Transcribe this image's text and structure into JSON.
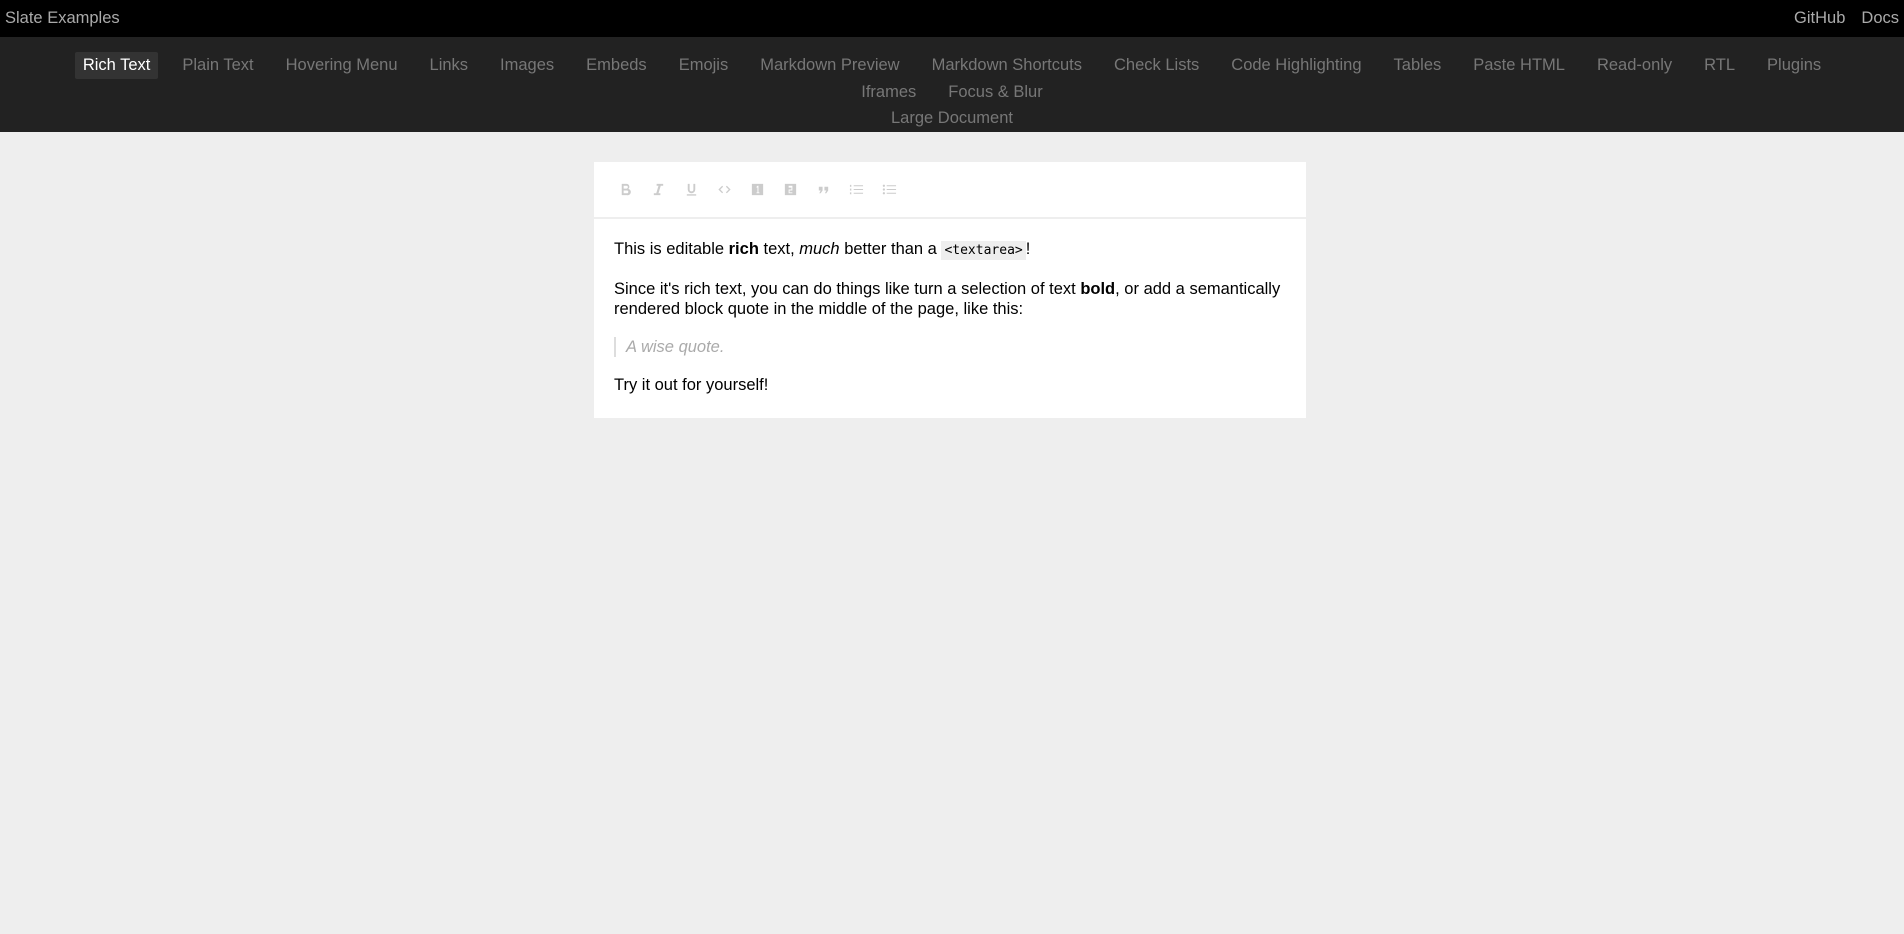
{
  "header": {
    "title": "Slate Examples",
    "links": [
      "GitHub",
      "Docs"
    ]
  },
  "tabs": [
    "Rich Text",
    "Plain Text",
    "Hovering Menu",
    "Links",
    "Images",
    "Embeds",
    "Emojis",
    "Markdown Preview",
    "Markdown Shortcuts",
    "Check Lists",
    "Code Highlighting",
    "Tables",
    "Paste HTML",
    "Read-only",
    "RTL",
    "Plugins",
    "Iframes",
    "Focus & Blur",
    "Large Document"
  ],
  "active_tab": "Rich Text",
  "toolbar": {
    "buttons": [
      {
        "icon": "bold-icon"
      },
      {
        "icon": "italic-icon"
      },
      {
        "icon": "underline-icon"
      },
      {
        "icon": "code-icon"
      },
      {
        "icon": "heading-one-icon"
      },
      {
        "icon": "heading-two-icon"
      },
      {
        "icon": "block-quote-icon"
      },
      {
        "icon": "numbered-list-icon"
      },
      {
        "icon": "bulleted-list-icon"
      }
    ]
  },
  "editor": {
    "p1": {
      "t1": "This is editable ",
      "bold": "rich",
      "t2": " text, ",
      "italic": "much",
      "t3": " better than a ",
      "code": "<textarea>",
      "t4": "!"
    },
    "p2": {
      "t1": "Since it's rich text, you can do things like turn a selection of text ",
      "bold": "bold",
      "t2": ", or add a semantically rendered block quote in the middle of the page, like this:"
    },
    "quote": "A wise quote.",
    "p3": "Try it out for yourself!"
  },
  "colors": {
    "topbar_bg": "#000000",
    "tabsbar_bg": "#222222",
    "page_bg": "#eeeeee",
    "active_tab_bg": "#333333"
  }
}
